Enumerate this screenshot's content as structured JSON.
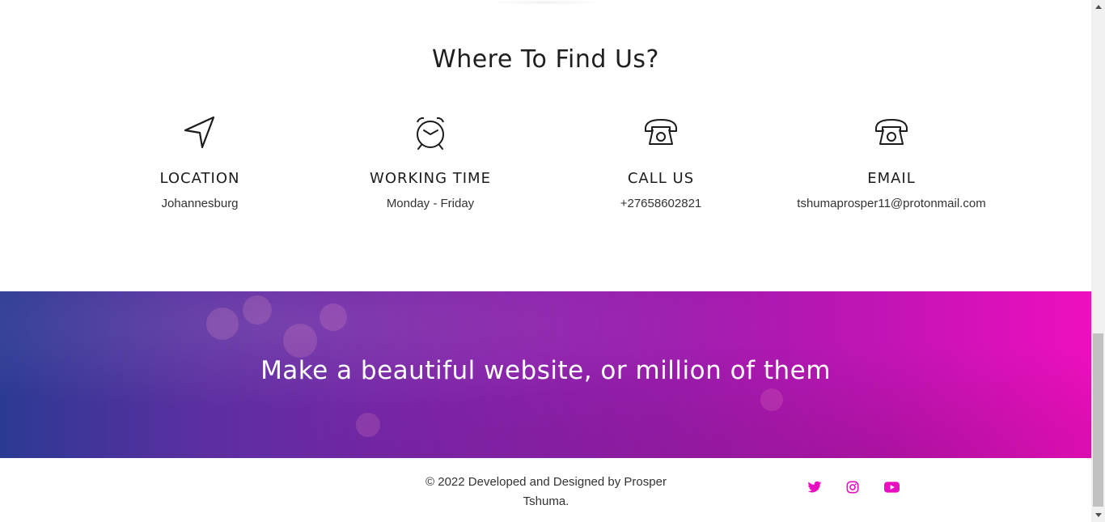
{
  "find_section": {
    "title": "Where To Find Us?",
    "items": [
      {
        "icon": "location-arrow-icon",
        "heading": "LOCATION",
        "value": "Johannesburg"
      },
      {
        "icon": "alarm-clock-icon",
        "heading": "WORKING TIME",
        "value": "Monday - Friday"
      },
      {
        "icon": "telephone-icon",
        "heading": "CALL US",
        "value": "+27658602821"
      },
      {
        "icon": "telephone-icon",
        "heading": "EMAIL",
        "value": "tshumaprosper11@protonmail.com"
      }
    ]
  },
  "banner": {
    "text": "Make a beautiful website, or million of them"
  },
  "footer": {
    "copyright_line1": "© 2022 Developed and Designed by Prosper",
    "copyright_line2": "Tshuma.",
    "social": [
      {
        "icon": "twitter-icon"
      },
      {
        "icon": "instagram-icon"
      },
      {
        "icon": "youtube-icon"
      }
    ]
  },
  "colors": {
    "accent": "#e70fbf",
    "banner_start": "#2b3a93",
    "banner_end": "#ee0fbe",
    "text_dark": "#1f1f1f"
  }
}
